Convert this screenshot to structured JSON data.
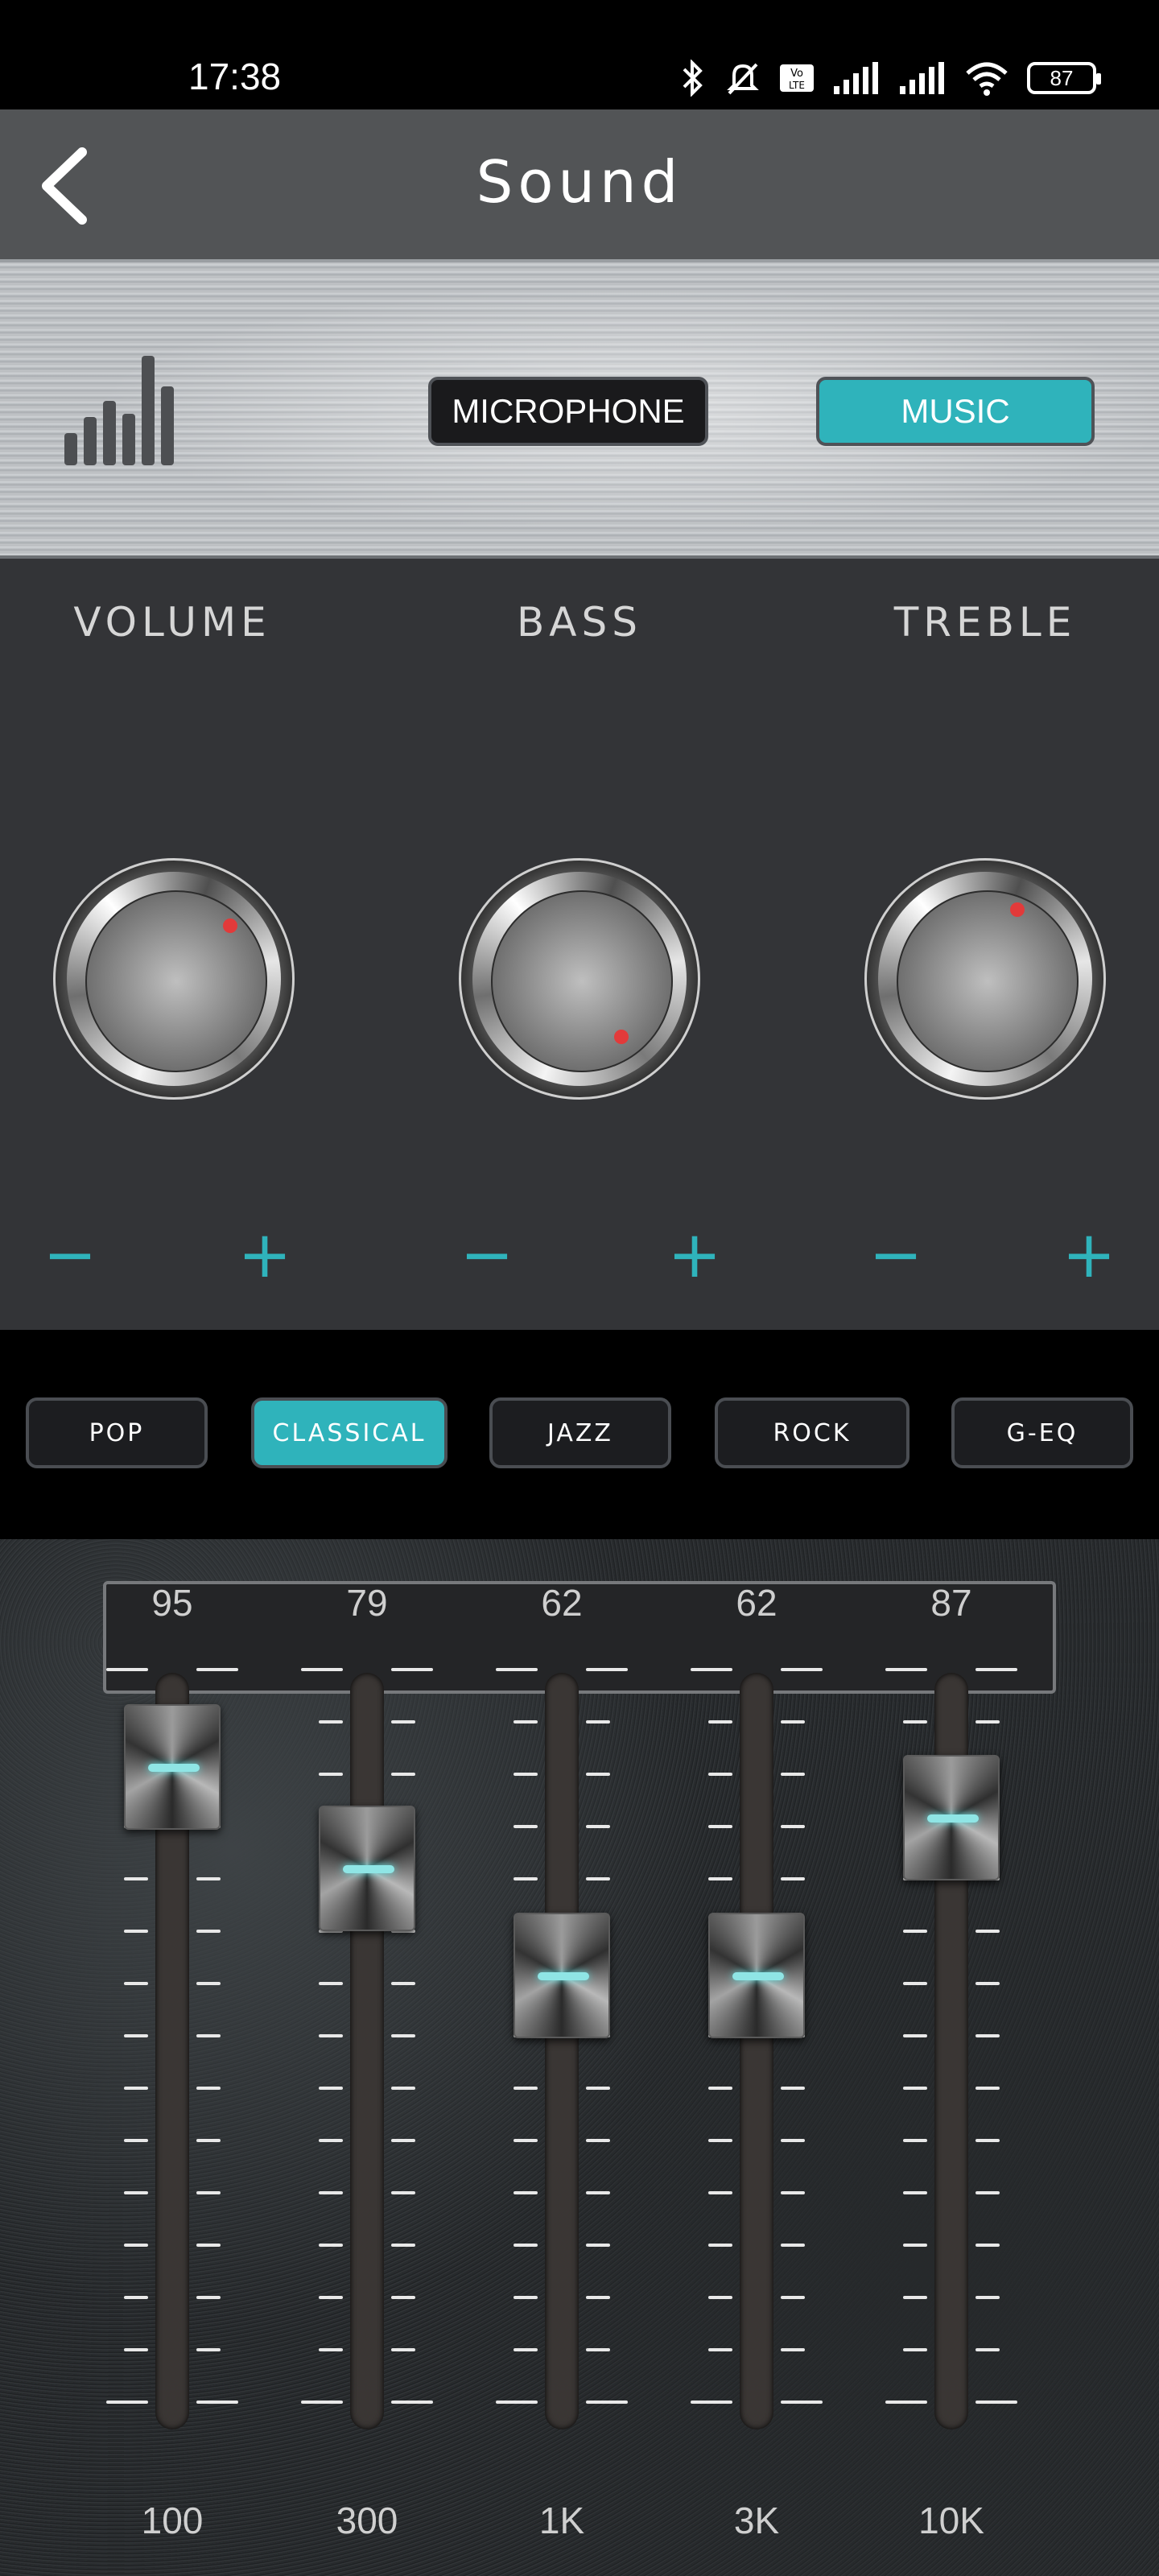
{
  "status_bar": {
    "time": "17:38",
    "battery": "87",
    "icons": [
      "bluetooth-icon",
      "mute-icon",
      "volte-icon",
      "signal-icon",
      "signal-icon-2",
      "wifi-icon"
    ]
  },
  "header": {
    "title": "Sound",
    "back_icon": "back-chevron-icon"
  },
  "source": {
    "microphone_label": "MICROPHONE",
    "music_label": "MUSIC",
    "selected": "MUSIC",
    "accent_color": "#2fb3bb"
  },
  "knobs": [
    {
      "label": "VOLUME",
      "minus": "−",
      "plus": "+"
    },
    {
      "label": "BASS",
      "minus": "−",
      "plus": "+"
    },
    {
      "label": "TREBLE",
      "minus": "−",
      "plus": "+"
    }
  ],
  "presets": {
    "items": [
      "POP",
      "CLASSICAL",
      "JAZZ",
      "ROCK",
      "G-EQ"
    ],
    "selected": "CLASSICAL"
  },
  "equalizer": {
    "bands": [
      {
        "freq": "100",
        "value": "95"
      },
      {
        "freq": "300",
        "value": "79"
      },
      {
        "freq": "1K",
        "value": "62"
      },
      {
        "freq": "3K",
        "value": "62"
      },
      {
        "freq": "10K",
        "value": "87"
      }
    ]
  }
}
